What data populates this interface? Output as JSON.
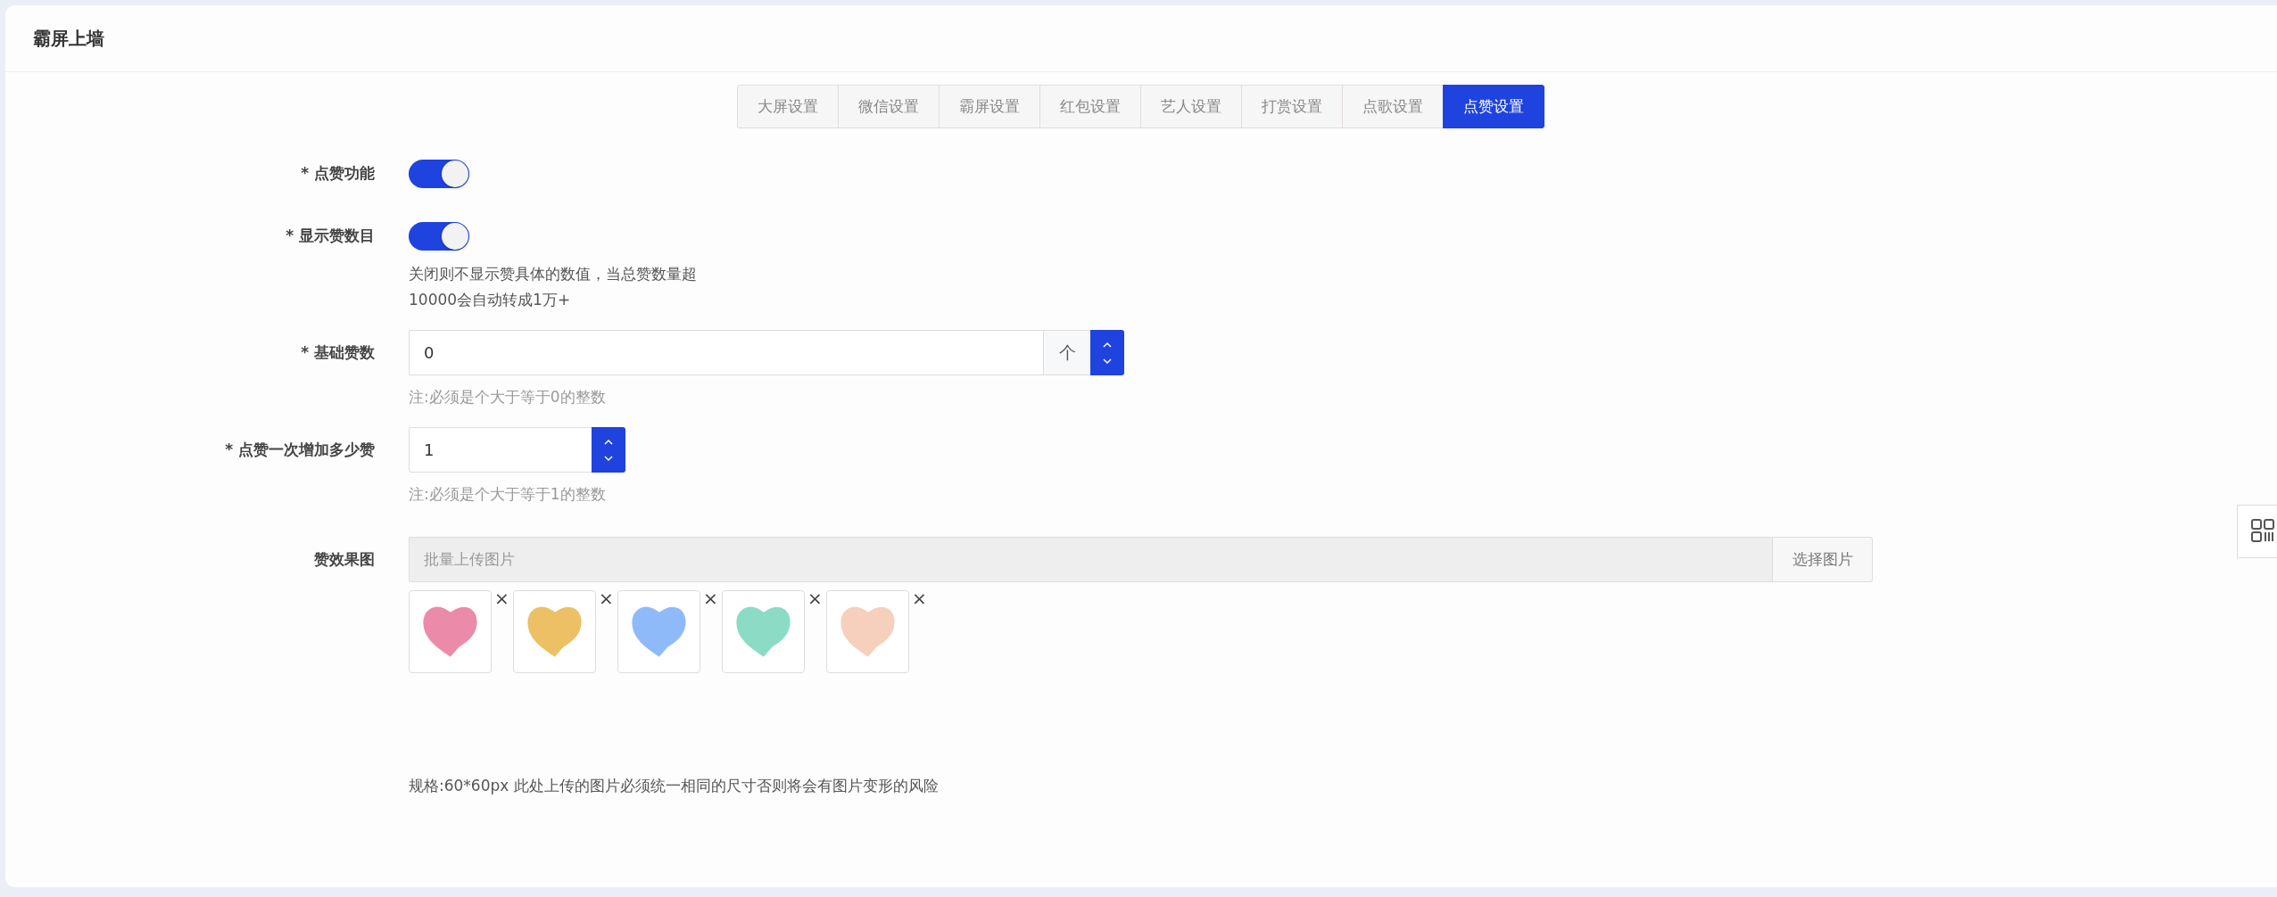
{
  "header": {
    "title": "霸屏上墙"
  },
  "tabs": [
    {
      "label": "大屏设置",
      "selected": false
    },
    {
      "label": "微信设置",
      "selected": false
    },
    {
      "label": "霸屏设置",
      "selected": false
    },
    {
      "label": "红包设置",
      "selected": false
    },
    {
      "label": "艺人设置",
      "selected": false
    },
    {
      "label": "打赏设置",
      "selected": false
    },
    {
      "label": "点歌设置",
      "selected": false
    },
    {
      "label": "点赞设置",
      "selected": true
    }
  ],
  "form": [
    {
      "kind": "switch",
      "label": "* 点赞功能",
      "on": true
    },
    {
      "kind": "switch",
      "label": "* 显示赞数目",
      "on": true,
      "help": [
        "关闭则不显示赞具体的数值，当总赞数量超",
        "10000会自动转成1万+"
      ]
    },
    {
      "kind": "number",
      "label": "* 基础赞数",
      "value": "0",
      "suffix": "个",
      "help": [
        "注:必须是个大于等于0的整数"
      ]
    },
    {
      "kind": "number",
      "label": "* 点赞一次增加多少赞",
      "value": "1",
      "help": [
        "注:必须是个大于等于1的整数"
      ]
    },
    {
      "kind": "upload",
      "label": "赞效果图",
      "placeholder": "批量上传图片",
      "button": "选择图片",
      "close": "×",
      "images": [
        {
          "color": "#ec8aa9"
        },
        {
          "color": "#edc066"
        },
        {
          "color": "#8fbafa"
        },
        {
          "color": "#8cdcc5"
        },
        {
          "color": "#f7cfbd"
        }
      ],
      "note": "规格:60*60px 此处上传的图片必须统一相同的尺寸否则将会有图片变形的风险"
    }
  ]
}
